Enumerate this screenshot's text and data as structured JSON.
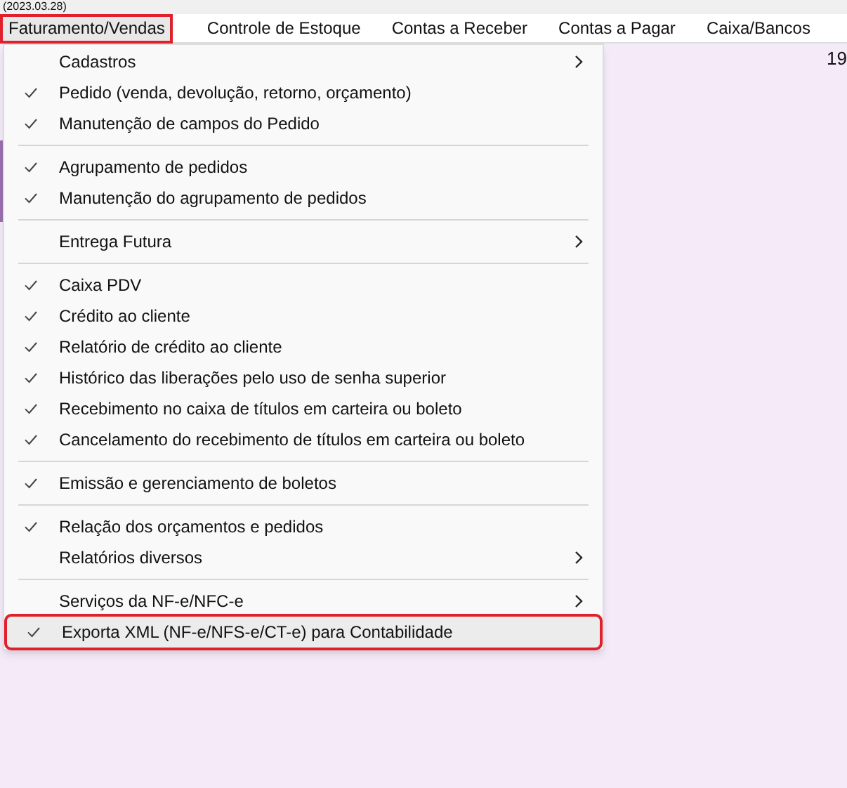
{
  "top_strip": {
    "text": "(2023.03.28)"
  },
  "menu_bar": [
    {
      "label": "Faturamento/Vendas",
      "selected": true,
      "highlighted": true
    },
    {
      "label": "Controle de Estoque",
      "selected": false,
      "highlighted": false
    },
    {
      "label": "Contas a Receber",
      "selected": false,
      "highlighted": false
    },
    {
      "label": "Contas a Pagar",
      "selected": false,
      "highlighted": false
    },
    {
      "label": "Caixa/Bancos",
      "selected": false,
      "highlighted": false
    }
  ],
  "background_text": "19",
  "menu_groups": [
    [
      {
        "label": "Cadastros",
        "checked": false,
        "submenu": true,
        "selected": false,
        "highlighted": false
      },
      {
        "label": "Pedido (venda, devolução, retorno, orçamento)",
        "checked": true,
        "submenu": false,
        "selected": false,
        "highlighted": false
      },
      {
        "label": "Manutenção de campos do Pedido",
        "checked": true,
        "submenu": false,
        "selected": false,
        "highlighted": false
      }
    ],
    [
      {
        "label": "Agrupamento de pedidos",
        "checked": true,
        "submenu": false,
        "selected": false,
        "highlighted": false
      },
      {
        "label": "Manutenção do agrupamento de pedidos",
        "checked": true,
        "submenu": false,
        "selected": false,
        "highlighted": false
      }
    ],
    [
      {
        "label": "Entrega Futura",
        "checked": false,
        "submenu": true,
        "selected": false,
        "highlighted": false
      }
    ],
    [
      {
        "label": "Caixa PDV",
        "checked": true,
        "submenu": false,
        "selected": false,
        "highlighted": false
      },
      {
        "label": "Crédito ao cliente",
        "checked": true,
        "submenu": false,
        "selected": false,
        "highlighted": false
      },
      {
        "label": "Relatório de crédito ao cliente",
        "checked": true,
        "submenu": false,
        "selected": false,
        "highlighted": false
      },
      {
        "label": "Histórico das liberações pelo uso de senha superior",
        "checked": true,
        "submenu": false,
        "selected": false,
        "highlighted": false
      },
      {
        "label": "Recebimento no caixa de títulos em carteira ou boleto",
        "checked": true,
        "submenu": false,
        "selected": false,
        "highlighted": false
      },
      {
        "label": "Cancelamento do recebimento de títulos em carteira ou boleto",
        "checked": true,
        "submenu": false,
        "selected": false,
        "highlighted": false
      }
    ],
    [
      {
        "label": "Emissão e gerenciamento de boletos",
        "checked": true,
        "submenu": false,
        "selected": false,
        "highlighted": false
      }
    ],
    [
      {
        "label": "Relação dos orçamentos e pedidos",
        "checked": true,
        "submenu": false,
        "selected": false,
        "highlighted": false
      },
      {
        "label": "Relatórios diversos",
        "checked": false,
        "submenu": true,
        "selected": false,
        "highlighted": false
      }
    ],
    [
      {
        "label": "Serviços da NF-e/NFC-e",
        "checked": false,
        "submenu": true,
        "selected": false,
        "highlighted": false
      },
      {
        "label": "Exporta XML (NF-e/NFS-e/CT-e) para Contabilidade",
        "checked": true,
        "submenu": false,
        "selected": true,
        "highlighted": true
      }
    ]
  ]
}
